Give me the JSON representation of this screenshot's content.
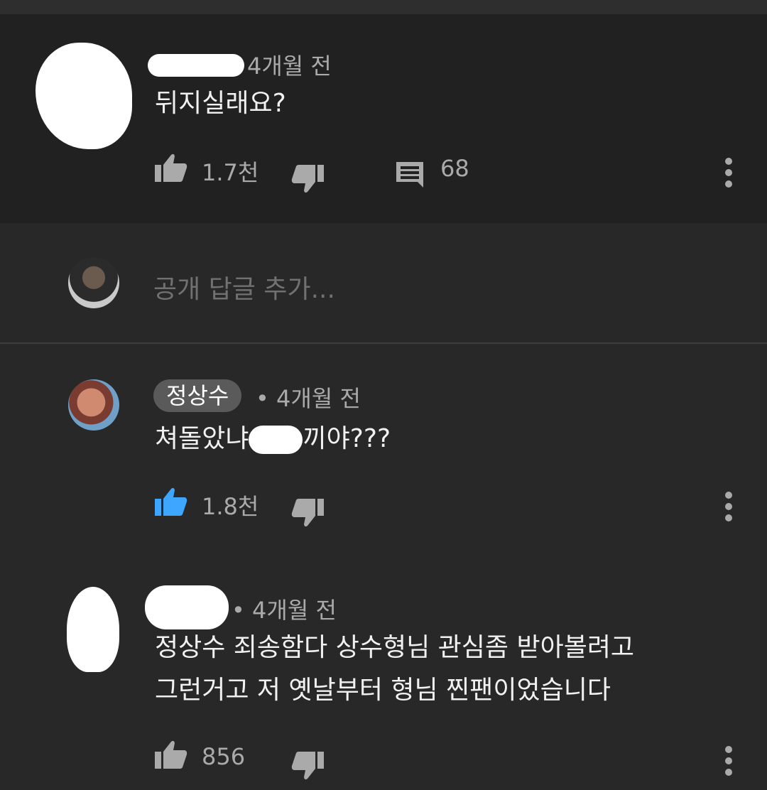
{
  "comment1": {
    "time": "4개월 전",
    "text": "뒤지실래요?",
    "likes": "1.7천",
    "replies": "68"
  },
  "reply_input": {
    "placeholder": "공개 답글 추가..."
  },
  "reply1": {
    "author": "정상수",
    "time": "• 4개월 전",
    "text_pre": "쳐돌았냐",
    "text_post": "끼야???",
    "likes": "1.8천",
    "liked": true
  },
  "reply2": {
    "time": "• 4개월 전",
    "line1": "정상수 죄송함다 상수형님 관심좀 받아볼려고",
    "line2": "그런거고 저 옛날부터 형님 찐팬이었습니다",
    "likes": "856"
  },
  "colors": {
    "liked_blue": "#3ea6ff",
    "icon_gray": "#aaaaaa"
  }
}
